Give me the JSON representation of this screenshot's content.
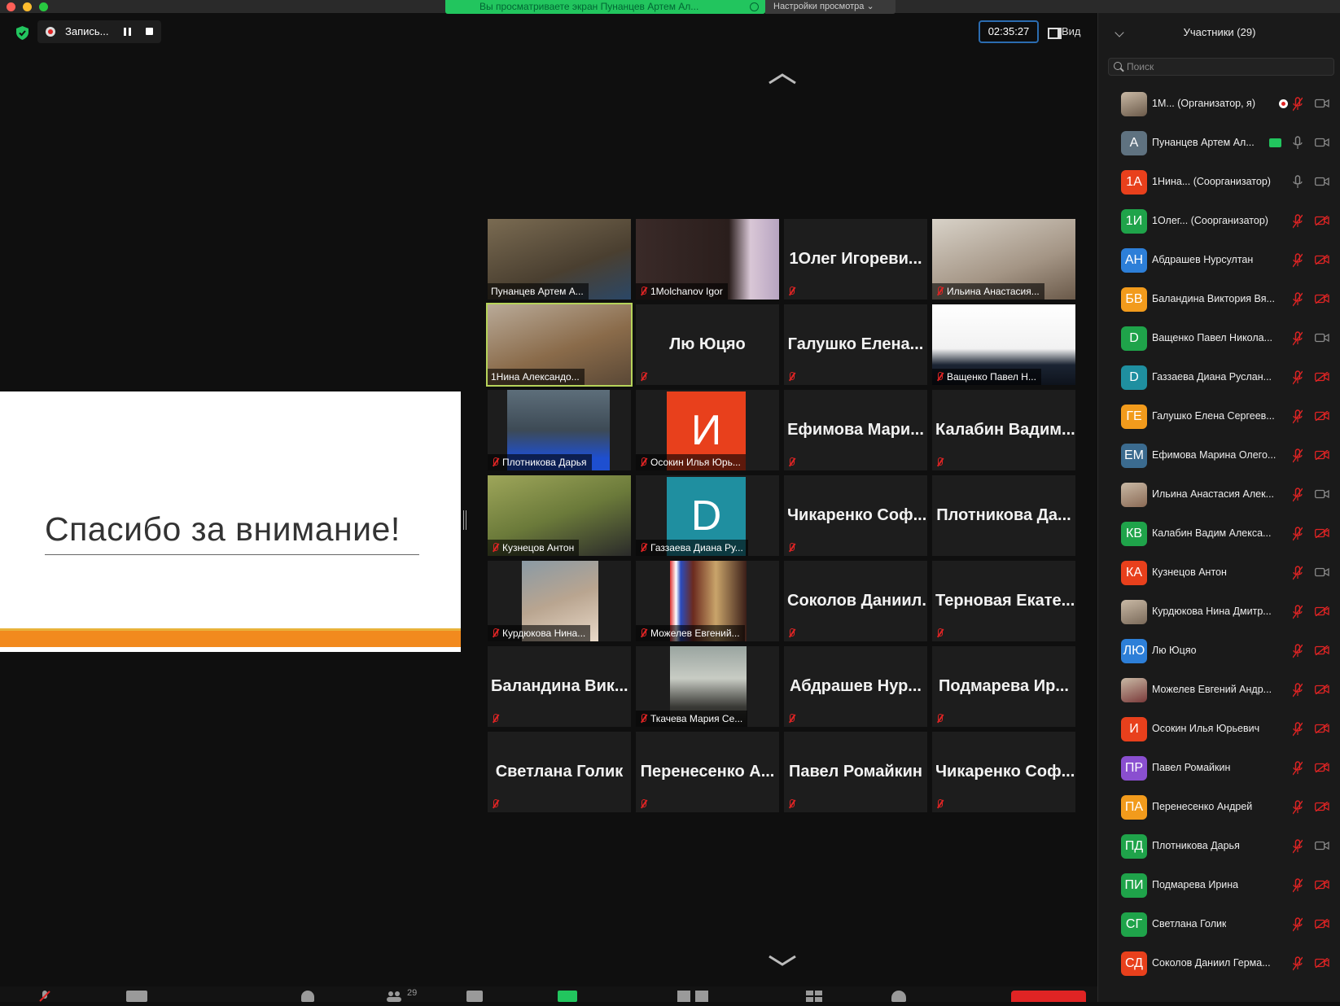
{
  "window": {
    "share_banner": "Вы просматриваете экран Пунанцев Артем Ал...",
    "view_options": "Настройки просмотра ⌄",
    "recording_label": "Запись...",
    "timer": "02:35:27",
    "view_label": "Вид"
  },
  "slide": {
    "text": "Спасибо за внимание!"
  },
  "gallery": [
    {
      "label": "Пунанцев Артем А...",
      "kind": "video",
      "muted": false
    },
    {
      "label": "1Molchanov Igor",
      "kind": "video",
      "muted": true
    },
    {
      "label": "1Олег Игореви...",
      "kind": "name",
      "muted": true
    },
    {
      "label": "Ильина Анастасия...",
      "kind": "video",
      "muted": true
    },
    {
      "label": "1Нина Александо...",
      "kind": "video",
      "muted": false,
      "speaking": true
    },
    {
      "label": "Лю Юцяо",
      "kind": "name",
      "muted": true
    },
    {
      "label": "Галушко Елена...",
      "kind": "name",
      "muted": true
    },
    {
      "label": "Ващенко Павел Н...",
      "kind": "video",
      "muted": true
    },
    {
      "label": "Плотникова Дарья",
      "kind": "video",
      "muted": true
    },
    {
      "label": "Осокин Илья Юрь...",
      "kind": "avatar",
      "letter": "И",
      "color": "#e8401c",
      "muted": true
    },
    {
      "label": "Ефимова Мари...",
      "kind": "name",
      "muted": true
    },
    {
      "label": "Калабин Вадим...",
      "kind": "name",
      "muted": true
    },
    {
      "label": "Кузнецов Антон",
      "kind": "video",
      "muted": true
    },
    {
      "label": "Газзаева Диана Ру...",
      "kind": "avatar",
      "letter": "D",
      "color": "#1f8fa0",
      "muted": true
    },
    {
      "label": "Чикаренко Соф...",
      "kind": "name",
      "muted": true
    },
    {
      "label": "Плотникова Да...",
      "kind": "name",
      "muted": false
    },
    {
      "label": "Курдюкова Нина...",
      "kind": "video",
      "muted": true
    },
    {
      "label": "Можелев Евгений...",
      "kind": "video",
      "muted": true
    },
    {
      "label": "Соколов Даниил...",
      "kind": "name",
      "muted": true
    },
    {
      "label": "Терновая Екате...",
      "kind": "name",
      "muted": true
    },
    {
      "label": "Баландина Вик...",
      "kind": "name",
      "muted": true
    },
    {
      "label": "Ткачева Мария Се...",
      "kind": "video",
      "muted": true
    },
    {
      "label": "Абдрашев Нур...",
      "kind": "name",
      "muted": true
    },
    {
      "label": "Подмарева Ир...",
      "kind": "name",
      "muted": true
    },
    {
      "label": "Светлана Голик",
      "kind": "name",
      "muted": true
    },
    {
      "label": "Перенесенко А...",
      "kind": "name",
      "muted": true
    },
    {
      "label": "Павел Ромайкин",
      "kind": "name",
      "muted": true
    },
    {
      "label": "Чикаренко Соф...",
      "kind": "name",
      "muted": true
    }
  ],
  "participants_panel": {
    "title": "Участники (29)",
    "search_placeholder": "Поиск",
    "rows": [
      {
        "initials": "",
        "name": "1M...    (Организатор, я)",
        "color": "#6b5a4a",
        "photo": true,
        "mic": "muted",
        "cam": "on",
        "rec": true
      },
      {
        "initials": "A",
        "name": "Пунанцев Артем Ал...",
        "color": "#5f7280",
        "mic": "on",
        "cam": "on",
        "share": true
      },
      {
        "initials": "1A",
        "name": "1Нина...    (Соорганизатор)",
        "color": "#e8401c",
        "mic": "on",
        "cam": "on"
      },
      {
        "initials": "1И",
        "name": "1Олег...    (Соорганизатор)",
        "color": "#1fa34a",
        "mic": "muted",
        "cam": "off"
      },
      {
        "initials": "АН",
        "name": "Абдрашев Нурсултан",
        "color": "#2d7fd8",
        "mic": "muted",
        "cam": "off"
      },
      {
        "initials": "БВ",
        "name": "Баландина Виктория Вя...",
        "color": "#f29b1c",
        "mic": "muted",
        "cam": "off"
      },
      {
        "initials": "D",
        "name": "Ващенко Павел Никола...",
        "color": "#1fa34a",
        "mic": "muted",
        "cam": "on"
      },
      {
        "initials": "D",
        "name": "Газзаева Диана Руслан...",
        "color": "#1f8fa0",
        "mic": "muted",
        "cam": "off"
      },
      {
        "initials": "ГЕ",
        "name": "Галушко Елена Сергеев...",
        "color": "#f29b1c",
        "mic": "muted",
        "cam": "off"
      },
      {
        "initials": "ЕМ",
        "name": "Ефимова Марина Олего...",
        "color": "#3b6b8f",
        "mic": "muted",
        "cam": "off"
      },
      {
        "initials": "",
        "name": "Ильина Анастасия Алек...",
        "color": "#8a6a55",
        "photo": true,
        "mic": "muted",
        "cam": "on"
      },
      {
        "initials": "КВ",
        "name": "Калабин Вадим Алекса...",
        "color": "#1fa34a",
        "mic": "muted",
        "cam": "off"
      },
      {
        "initials": "КА",
        "name": "Кузнецов Антон",
        "color": "#e8401c",
        "mic": "muted",
        "cam": "on"
      },
      {
        "initials": "",
        "name": "Курдюкова Нина Дмитр...",
        "color": "#7a6a5a",
        "photo": true,
        "mic": "muted",
        "cam": "off"
      },
      {
        "initials": "ЛЮ",
        "name": "Лю Юцяо",
        "color": "#2d7fd8",
        "mic": "muted",
        "cam": "off"
      },
      {
        "initials": "",
        "name": "Можелев Евгений Андр...",
        "color": "#7a3a3a",
        "photo": true,
        "mic": "muted",
        "cam": "off"
      },
      {
        "initials": "И",
        "name": "Осокин Илья Юрьевич",
        "color": "#e8401c",
        "mic": "muted",
        "cam": "off"
      },
      {
        "initials": "ПР",
        "name": "Павел Ромайкин",
        "color": "#8a4fd0",
        "mic": "muted",
        "cam": "off"
      },
      {
        "initials": "ПА",
        "name": "Перенесенко Андрей",
        "color": "#f29b1c",
        "mic": "muted",
        "cam": "off"
      },
      {
        "initials": "ПД",
        "name": "Плотникова Дарья",
        "color": "#1fa34a",
        "mic": "muted",
        "cam": "on"
      },
      {
        "initials": "ПИ",
        "name": "Подмарева Ирина",
        "color": "#1fa34a",
        "mic": "muted",
        "cam": "off"
      },
      {
        "initials": "СГ",
        "name": "Светлана Голик",
        "color": "#1fa34a",
        "mic": "muted",
        "cam": "off"
      },
      {
        "initials": "СД",
        "name": "Соколов Даниил Герма...",
        "color": "#e8401c",
        "mic": "muted",
        "cam": "off"
      }
    ]
  },
  "colors": {
    "accent_green": "#22c55e",
    "muted_red": "#e02424",
    "speaker_highlight": "#b6d35a",
    "timer_border": "#2b6cb0"
  },
  "toolbar": {
    "participants_count": "29"
  }
}
